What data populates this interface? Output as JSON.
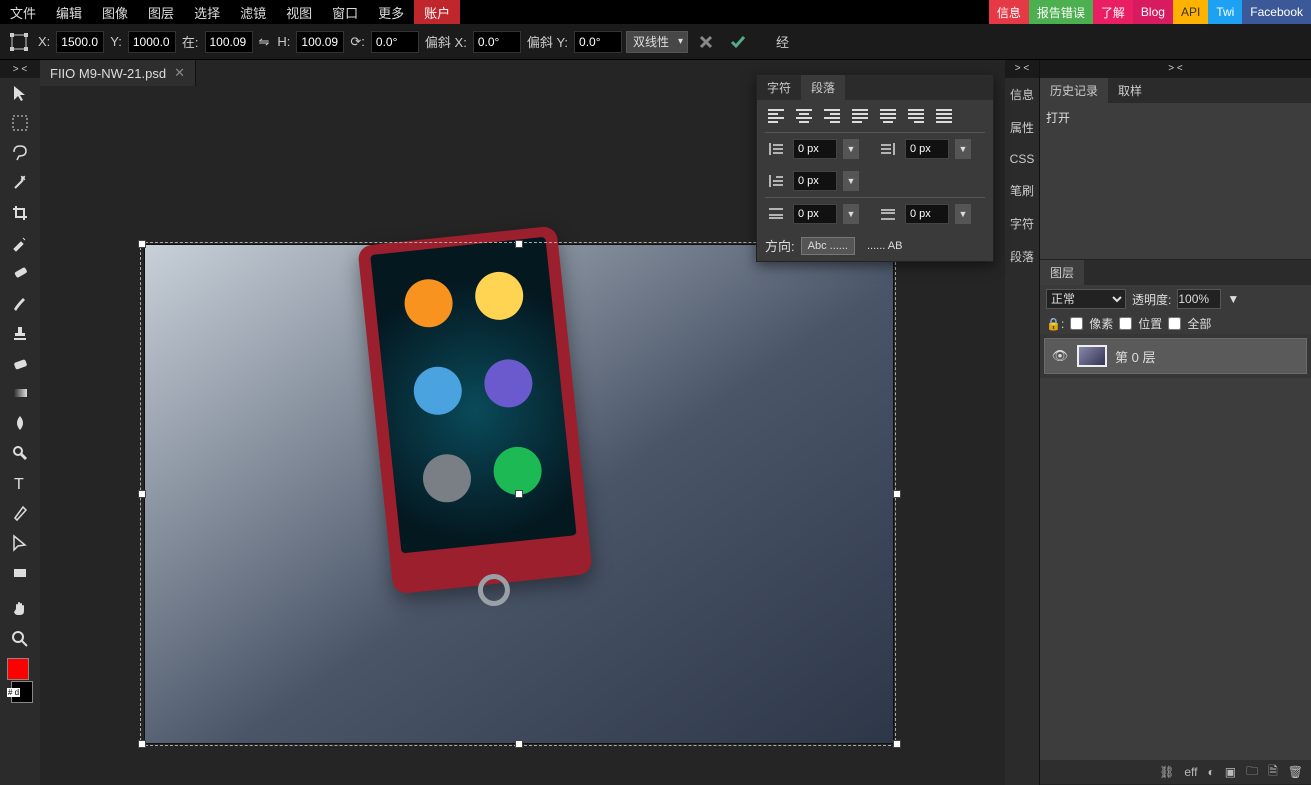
{
  "menu": {
    "items": [
      "文件",
      "编辑",
      "图像",
      "图层",
      "选择",
      "滤镜",
      "视图",
      "窗口",
      "更多"
    ],
    "account": "账户",
    "social": {
      "info": "信息",
      "bug": "报告错误",
      "learn": "了解",
      "blog": "Blog",
      "api": "API",
      "twi": "Twi",
      "fb": "Facebook"
    }
  },
  "optbar": {
    "x_label": "X:",
    "x": "1500.0",
    "y_label": "Y:",
    "y": "1000.0",
    "w_label": "在:",
    "w": "100.09",
    "h_label": "H:",
    "h": "100.09",
    "rot_label": "⟳:",
    "rot": "0.0°",
    "skewx_label": "偏斜 X:",
    "skewx": "0.0°",
    "skewy_label": "偏斜 Y:",
    "skewy": "0.0°",
    "interp": "双线性",
    "warp": "经"
  },
  "document": {
    "title": "FIIO M9-NW-21.psd"
  },
  "tools_collapse": "> <",
  "rstack": {
    "collapse": "> <",
    "items": [
      "信息",
      "属性",
      "CSS",
      "笔刷",
      "字符",
      "段落"
    ]
  },
  "rpanels": {
    "collapse": "> <",
    "history": {
      "tabs": [
        "历史记录",
        "取样"
      ],
      "item": "打开"
    },
    "layers": {
      "tab": "图层",
      "blend": "正常",
      "opacity_label": "透明度:",
      "opacity": "100%",
      "locks": {
        "pixels": "像素",
        "position": "位置",
        "all": "全部"
      },
      "layer_name": "第 0 层",
      "footer_eff": "eff"
    }
  },
  "float": {
    "tabs": [
      "字符",
      "段落"
    ],
    "indent_left": "0 px",
    "indent_right": "0 px",
    "indent_first": "0 px",
    "space_before": "0 px",
    "space_after": "0 px",
    "dir_label": "方向:",
    "dir_ltr": "Abc ......",
    "dir_rtl": "...... AB"
  },
  "colors": {
    "fg": "#ff0000",
    "bg": "#000000",
    "hex_label": "# d"
  }
}
